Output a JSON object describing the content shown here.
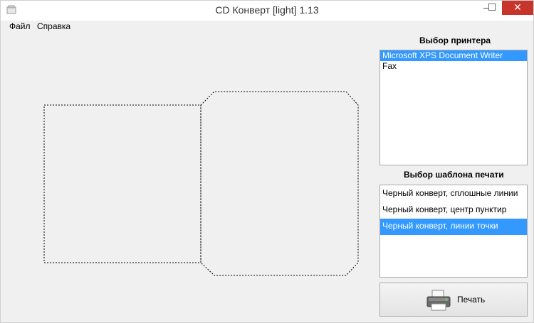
{
  "window": {
    "title": "CD Конверт [light] 1.13",
    "minimize": "–",
    "maximize": "☐",
    "close": "✕"
  },
  "menu": {
    "file": "Файл",
    "help": "Справка"
  },
  "printers": {
    "title": "Выбор принтера",
    "items": [
      "Microsoft XPS Document Writer",
      "Fax"
    ],
    "selected_index": 0
  },
  "templates": {
    "title": "Выбор шаблона печати",
    "items": [
      "Черный конверт, сплошные линии",
      "Черный конверт, центр пунктир",
      "Черный конверт, линии точки"
    ],
    "selected_index": 2
  },
  "print_button": {
    "label": "Печать",
    "icon": "printer-icon"
  },
  "colors": {
    "selection": "#3399ff",
    "close": "#c7342b"
  }
}
